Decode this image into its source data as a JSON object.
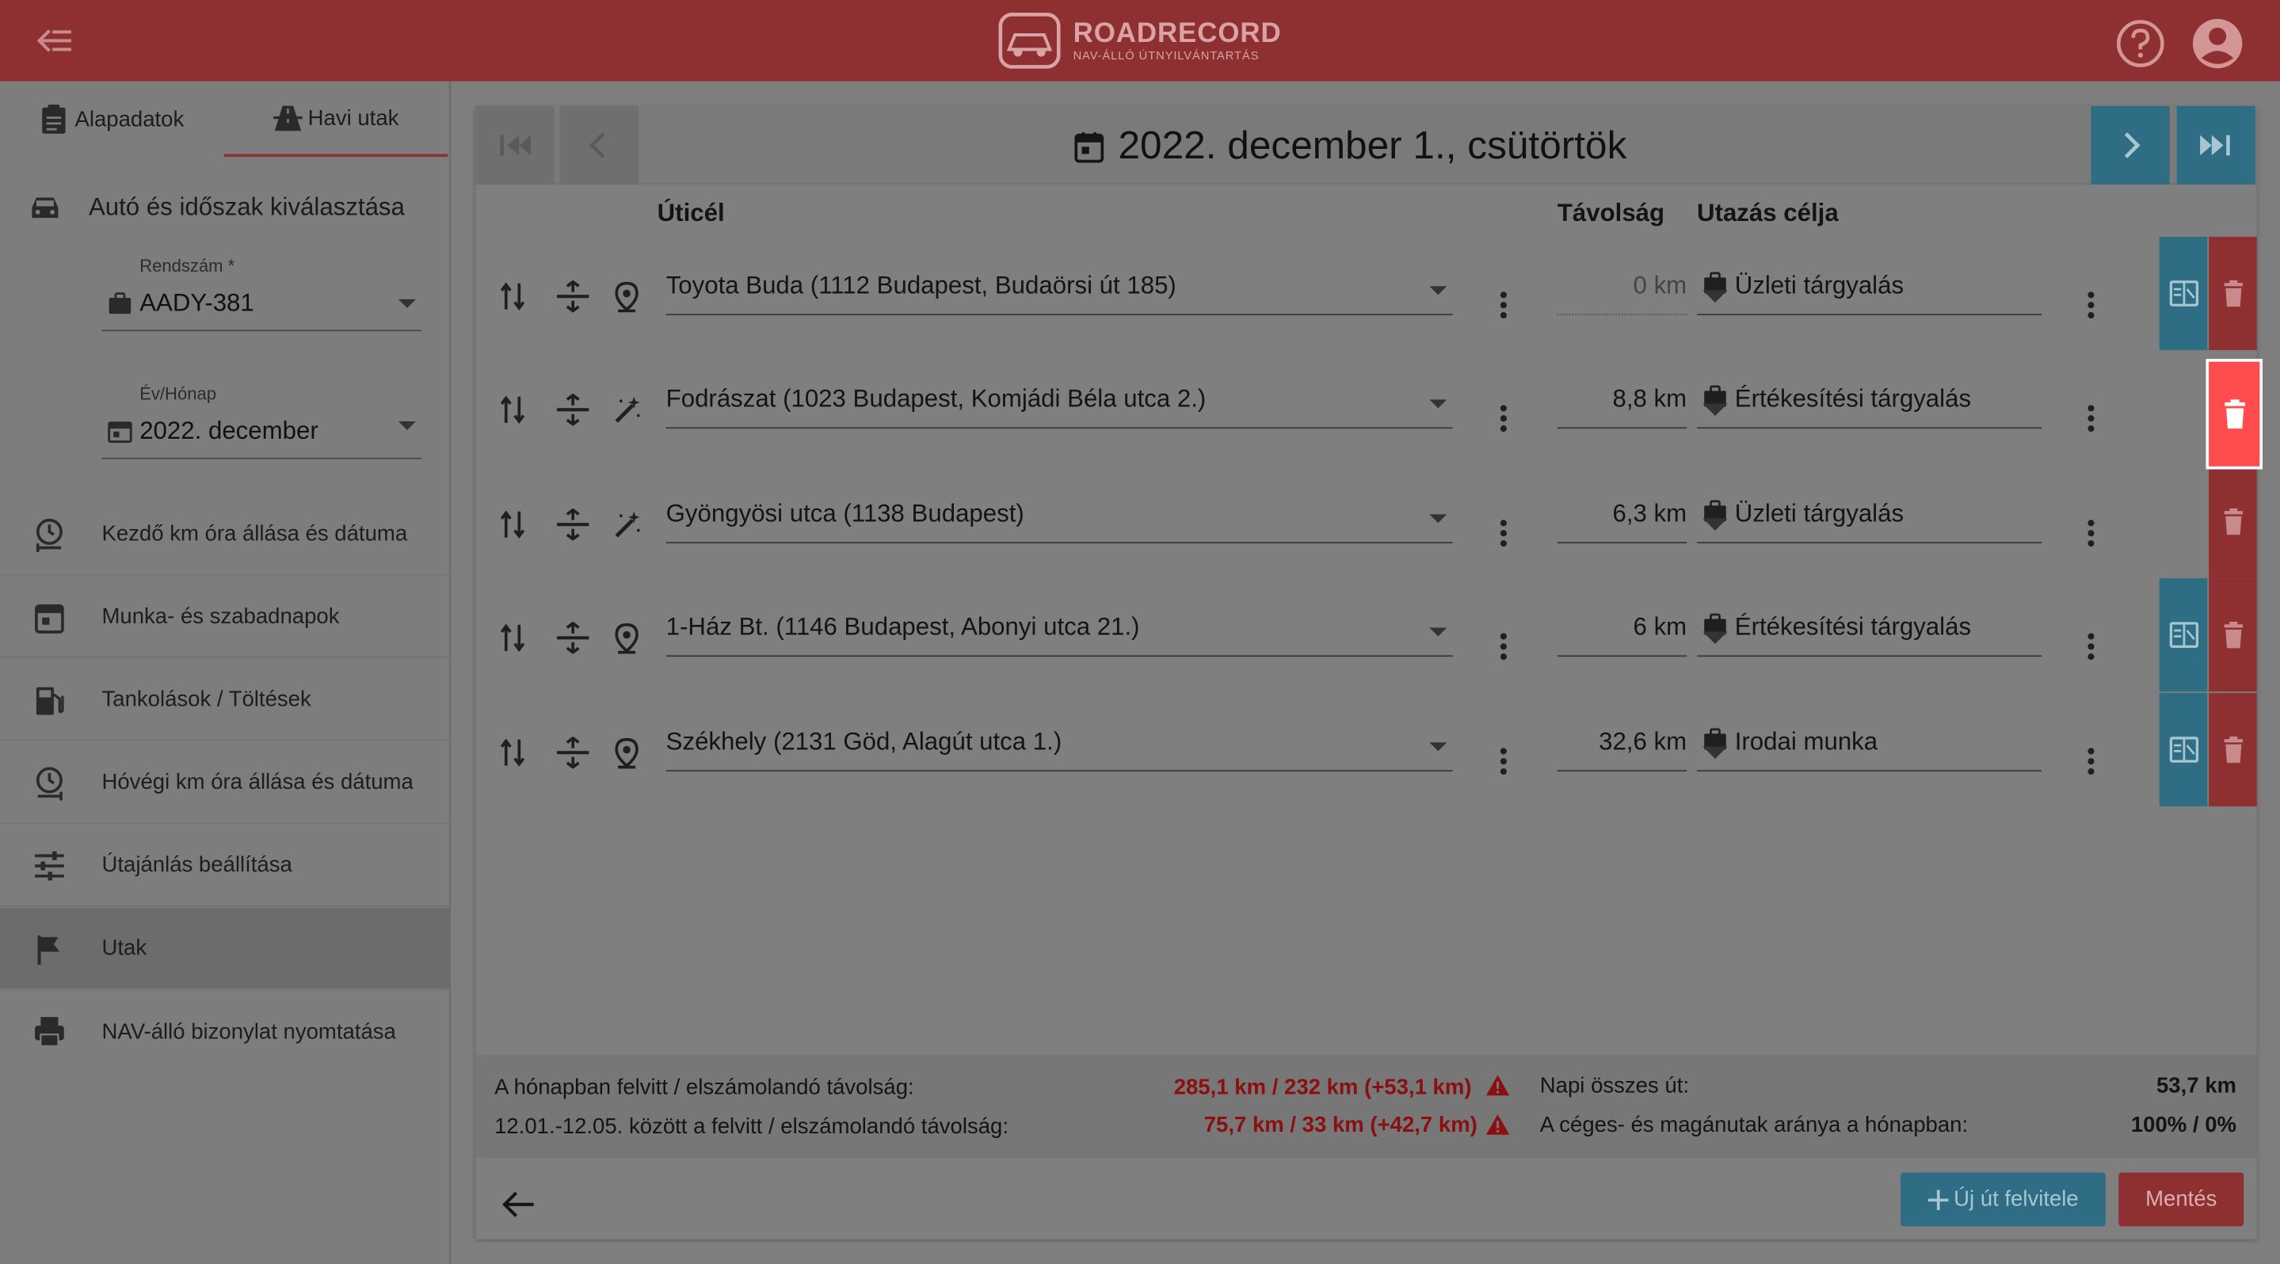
{
  "app": {
    "brand_name": "ROADRECORD",
    "brand_tagline": "NAV-ÁLLÓ ÚTNYILVÁNTARTÁS"
  },
  "sidebar": {
    "tabs": [
      {
        "label": "Alapadatok",
        "icon": "clipboard-icon"
      },
      {
        "label": "Havi utak",
        "icon": "road-icon",
        "active": true
      }
    ],
    "section_title": "Autó és időszak kiválasztása",
    "plate_field": {
      "label": "Rendszám *",
      "value": "AADY-381"
    },
    "month_field": {
      "label": "Év/Hónap",
      "value": "2022. december"
    },
    "menu": [
      {
        "label": "Kezdő km óra állása és dátuma",
        "icon": "odometer-start-icon"
      },
      {
        "label": "Munka- és szabadnapok",
        "icon": "calendar-icon"
      },
      {
        "label": "Tankolások / Töltések",
        "icon": "fuel-icon"
      },
      {
        "label": "Hóvégi km óra állása és dátuma",
        "icon": "odometer-end-icon"
      },
      {
        "label": "Útajánlás beállítása",
        "icon": "sliders-icon"
      },
      {
        "label": "Utak",
        "icon": "flag-icon",
        "active": true
      },
      {
        "label": "NAV-álló bizonylat nyomtatása",
        "icon": "printer-icon"
      }
    ]
  },
  "main": {
    "date_title": "2022. december 1., csütörtök",
    "columns": {
      "destination": "Úticél",
      "distance": "Távolság",
      "purpose": "Utazás célja"
    },
    "rows": [
      {
        "destination": "Toyota Buda (1112 Budapest, Budaörsi út 185)",
        "distance": "0 km",
        "purpose": "Üzleti tárgyalás",
        "type_icon": "location-pin-icon"
      },
      {
        "destination": "Fodrászat (1023 Budapest, Komjádi Béla utca 2.)",
        "distance": "8,8 km",
        "purpose": "Értékesítési tárgyalás",
        "type_icon": "magic-wand-icon"
      },
      {
        "destination": "Gyöngyösi utca (1138 Budapest)",
        "distance": "6,3 km",
        "purpose": "Üzleti tárgyalás",
        "type_icon": "magic-wand-icon"
      },
      {
        "destination": "1-Ház Bt. (1146 Budapest, Abonyi utca 21.)",
        "distance": "6 km",
        "purpose": "Értékesítési tárgyalás",
        "type_icon": "location-pin-icon"
      },
      {
        "destination": "Székhely (2131 Göd, Alagút utca 1.)",
        "distance": "32,6 km",
        "purpose": "Irodai munka",
        "type_icon": "location-pin-icon"
      }
    ],
    "summary": {
      "monthly_label": "A hónapban felvitt / elszámolandó távolság:",
      "monthly_value": "285,1 km / 232 km (+53,1 km)",
      "range_label": "12.01.-12.05. között a felvitt / elszámolandó távolság:",
      "range_value": "75,7 km / 33 km (+42,7 km)",
      "daily_label": "Napi összes út:",
      "daily_value": "53,7 km",
      "ratio_label": "A céges- és magánutak aránya a hónapban:",
      "ratio_value": "100% / 0%"
    },
    "buttons": {
      "new_trip": "Új út felvitele",
      "save": "Mentés"
    }
  }
}
